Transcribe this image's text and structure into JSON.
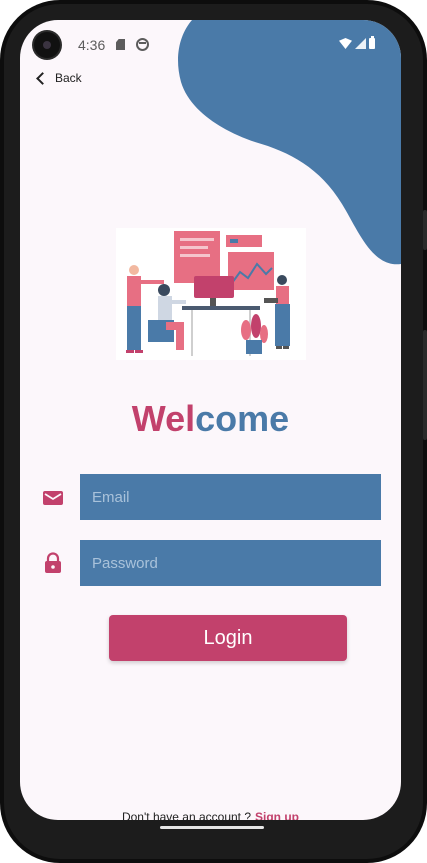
{
  "status_bar": {
    "time": "4:36"
  },
  "nav": {
    "back_label": "Back"
  },
  "welcome": {
    "part1": "Wel",
    "part2": "come"
  },
  "form": {
    "email_placeholder": "Email",
    "email_value": "",
    "password_placeholder": "Password",
    "password_value": "",
    "login_label": "Login"
  },
  "footer": {
    "prompt": "Don't have an account ?",
    "signup_label": "Sign up"
  },
  "icons": {
    "email": "mail-icon",
    "password": "lock-icon",
    "back": "chevron-left-icon"
  },
  "colors": {
    "primary": "#c2416c",
    "secondary": "#4a7aa8",
    "background": "#fcf7fb"
  }
}
